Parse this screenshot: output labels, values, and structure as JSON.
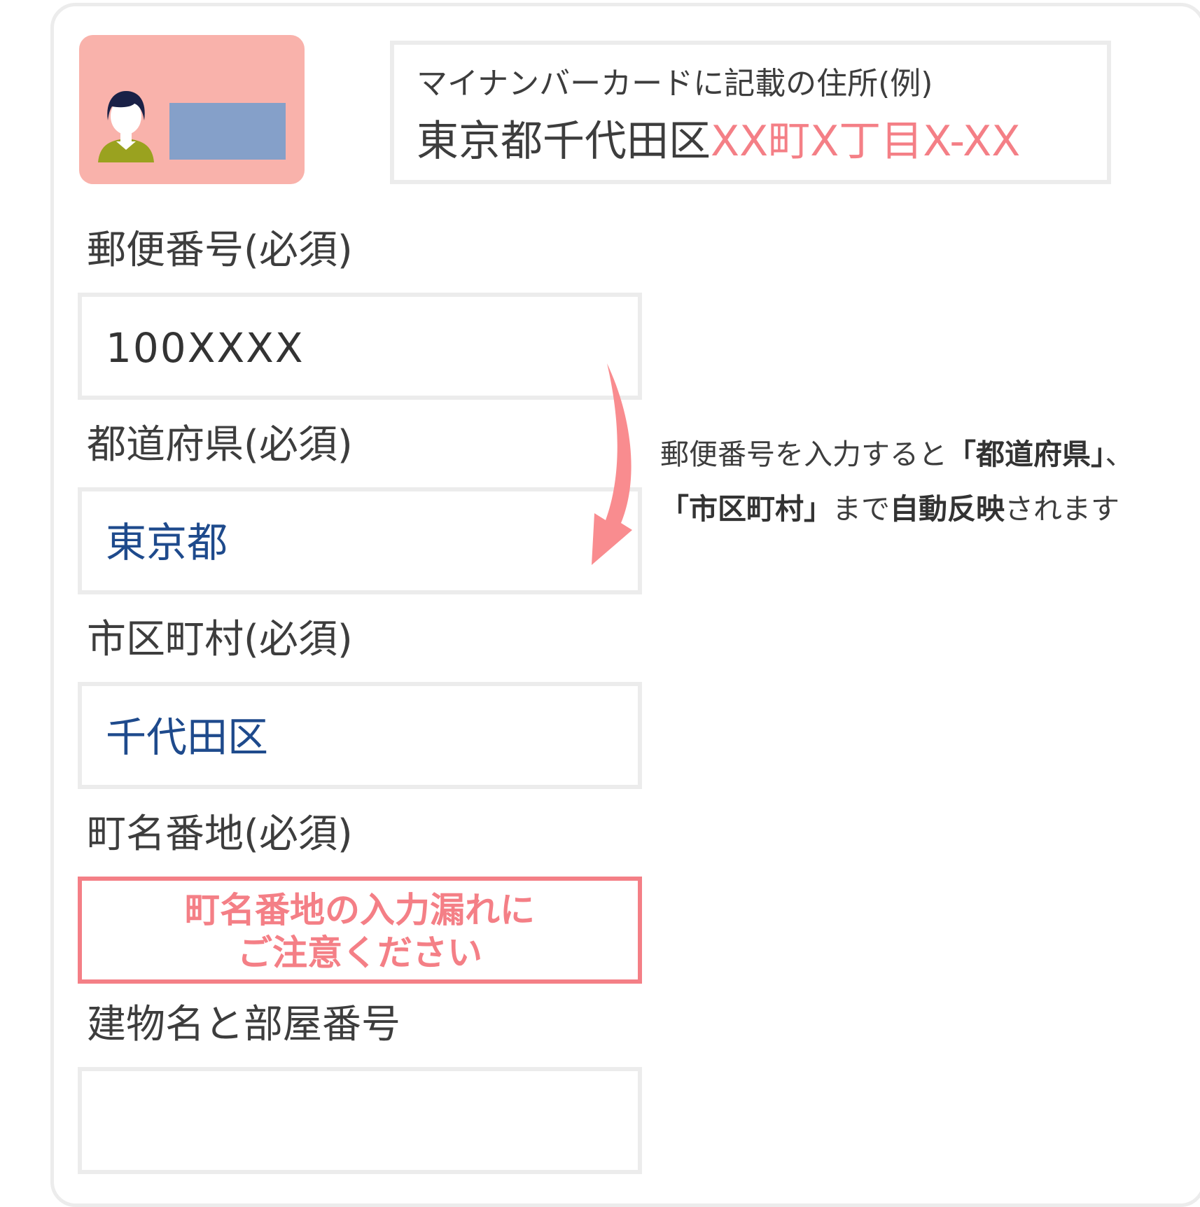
{
  "example": {
    "label": "マイナンバーカードに記載の住所(例)",
    "address_base": "東京都千代田区",
    "address_highlight": "XX町X丁目X-XX"
  },
  "fields": {
    "postal": {
      "label": "郵便番号(必須)",
      "value": "100XXXX"
    },
    "prefecture": {
      "label": "都道府県(必須)",
      "value": "東京都"
    },
    "city": {
      "label": "市区町村(必須)",
      "value": "千代田区"
    },
    "street": {
      "label": "町名番地(必須)",
      "alert_line1": "町名番地の入力漏れに",
      "alert_line2": "ご注意ください"
    },
    "building": {
      "label": "建物名と部屋番号",
      "value": ""
    }
  },
  "note": {
    "line1_a": "郵便番号を入力すると",
    "line1_b": "「都道府県」",
    "line1_c": "、",
    "line2_a": "「市区町村」",
    "line2_b": "まで",
    "line2_c": "自動反映",
    "line2_d": "されます"
  },
  "colors": {
    "accent": "#f47f86",
    "card_bg": "#f9b2ab",
    "card_block": "#85a0c9",
    "autofill_text": "#1e4a8c",
    "border": "#ececec"
  },
  "icons": {
    "card": "mynumber-card-icon",
    "person": "person-icon",
    "arrow": "curved-arrow-icon"
  }
}
